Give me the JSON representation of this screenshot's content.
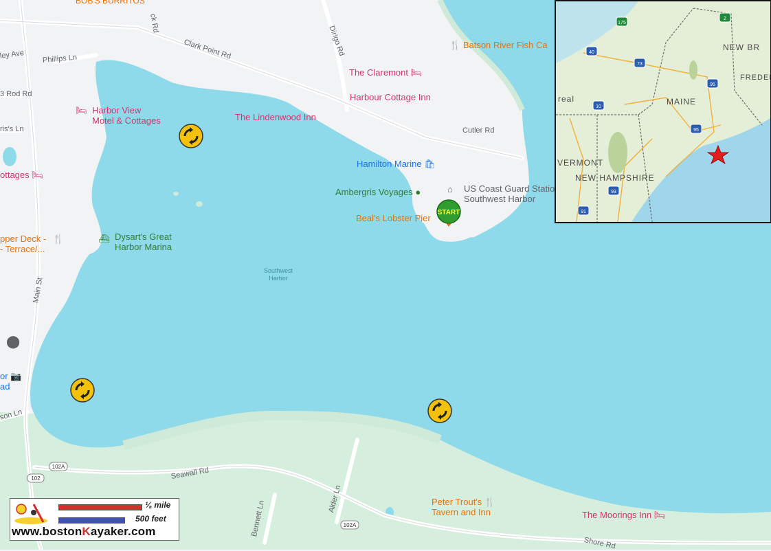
{
  "map": {
    "water_label": [
      "Southwest",
      "Harbor"
    ],
    "pois": [
      {
        "name": "poi-batson-river",
        "text": "Batson River Fish Ca",
        "type": "restaurant",
        "color": "orange"
      },
      {
        "name": "poi-the-claremont",
        "text": "The Claremont",
        "type": "hotel",
        "color": "pink"
      },
      {
        "name": "poi-harbour-cottage-inn",
        "text": "Harbour Cottage Inn",
        "type": "hotel",
        "color": "pink"
      },
      {
        "name": "poi-harbor-view",
        "lines": [
          "Harbor View",
          "Motel & Cottages"
        ],
        "type": "hotel",
        "color": "pink"
      },
      {
        "name": "poi-lindenwood-inn",
        "text": "The Lindenwood Inn",
        "type": "hotel",
        "color": "pink"
      },
      {
        "name": "poi-cottages",
        "text": "ottages",
        "type": "hotel",
        "color": "pink"
      },
      {
        "name": "poi-hamilton-marine",
        "text": "Hamilton Marine",
        "type": "shop",
        "color": "blue"
      },
      {
        "name": "poi-ambergris-voyages",
        "text": "Ambergris Voyages",
        "type": "place",
        "color": "green"
      },
      {
        "name": "poi-coast-guard",
        "lines": [
          "US Coast Guard Statio",
          "Southwest Harbor"
        ],
        "type": "government",
        "color": "gray"
      },
      {
        "name": "poi-beals-lobster-pier",
        "text": "Beal's Lobster Pier",
        "type": "restaurant",
        "color": "orange"
      },
      {
        "name": "poi-upper-deck",
        "lines": [
          "pper Deck -",
          "- Terrace/..."
        ],
        "type": "restaurant",
        "color": "orange"
      },
      {
        "name": "poi-dysarts",
        "lines": [
          "Dysart's Great",
          "Harbor Marina"
        ],
        "type": "marina",
        "color": "green"
      },
      {
        "name": "poi-peter-trouts",
        "lines": [
          "Peter Trout's",
          "Tavern and Inn"
        ],
        "type": "restaurant",
        "color": "orange"
      },
      {
        "name": "poi-moorings-inn",
        "text": "The Moorings Inn",
        "type": "hotel",
        "color": "pink"
      },
      {
        "name": "poi-edge-or-ad",
        "lines": [
          "or",
          "ad"
        ],
        "type": "camera",
        "color": "blue"
      }
    ],
    "roads": [
      {
        "name": "road-clark-point",
        "text": "Clark Point Rd"
      },
      {
        "name": "road-dirigo",
        "text": "Dirigo Rd"
      },
      {
        "name": "road-cutler",
        "text": "Cutler Rd"
      },
      {
        "name": "road-main-st",
        "text": "Main St"
      },
      {
        "name": "road-seawall",
        "text": "Seawall Rd"
      },
      {
        "name": "road-alder",
        "text": "Alder Ln"
      },
      {
        "name": "road-bennett",
        "text": "Bennett Ln"
      },
      {
        "name": "road-shore",
        "text": "Shore Rd"
      },
      {
        "name": "road-phillips",
        "text": "Phillips Ln"
      },
      {
        "name": "road-ley-ave",
        "text": "ley Ave"
      },
      {
        "name": "road-3-rod",
        "text": "3 Rod Rd"
      },
      {
        "name": "road-ris-ln",
        "text": "ris's Ln"
      },
      {
        "name": "road-son-ln",
        "text": "son Ln"
      },
      {
        "name": "road-ck-rd",
        "text": "ck Rd"
      },
      {
        "name": "road-bobs-burritos",
        "text": "BOB'S BURRITOS"
      }
    ],
    "shields": [
      {
        "name": "route-102a-shield-west",
        "text": "102A"
      },
      {
        "name": "route-102-shield",
        "text": "102"
      },
      {
        "name": "route-102a-shield-south",
        "text": "102A"
      }
    ],
    "start_marker": "START",
    "paddle_markers": 3
  },
  "inset": {
    "labels": {
      "maine": "MAINE",
      "new_hampshire": "NEW HAMPSHIRE",
      "vermont": "VERMONT",
      "new_br": "NEW BR",
      "frederi": "FREDER",
      "real": "real"
    },
    "highways": [
      "175",
      "40",
      "73",
      "95",
      "10",
      "95",
      "93",
      "91",
      "2"
    ],
    "star_marker": "location-star"
  },
  "scale": {
    "miles_label": "⅛ mile",
    "feet_label": "500 feet",
    "colors": {
      "mile_bar": "#d0312d",
      "feet_bar": "#3f51b5"
    },
    "site": {
      "pre": "www.boston",
      "k": "K",
      "post": "ayaker.com"
    }
  },
  "colors": {
    "water": "#8fdaea",
    "land": "#f1f3f4",
    "green_land": "#cfead8",
    "marker_yellow": "#f4c20d",
    "start_green": "#2e9c2e"
  }
}
